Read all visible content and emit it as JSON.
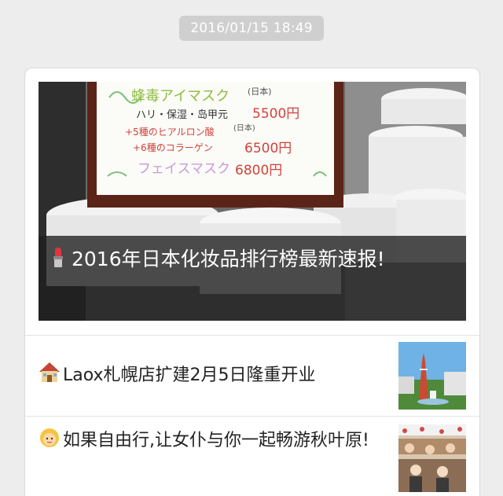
{
  "timestamp": "2016/01/15 18:49",
  "main_article": {
    "emoji": "lipstick-icon",
    "title": "2016年日本化妆品排行榜最新速报!",
    "cover_sign": {
      "line1": "蜂毒アイマスク",
      "line1_note": "(日本)",
      "line2": "ハリ・保湿・岛甲元",
      "line2_price": "5500円",
      "line3": "+5種のヒアルロン酸",
      "line3_note": "(日本)",
      "line4": "+6種のコラーゲン",
      "line4_price": "6500円",
      "line5": "フェイスマスク",
      "line5_price": "6800円"
    }
  },
  "sub_articles": [
    {
      "emoji": "house-icon",
      "title": "Laox札幌店扩建2月5日隆重开业"
    },
    {
      "emoji": "girl-face-icon",
      "title": "如果自由行,让女仆与你一起畅游秋叶原!"
    }
  ]
}
